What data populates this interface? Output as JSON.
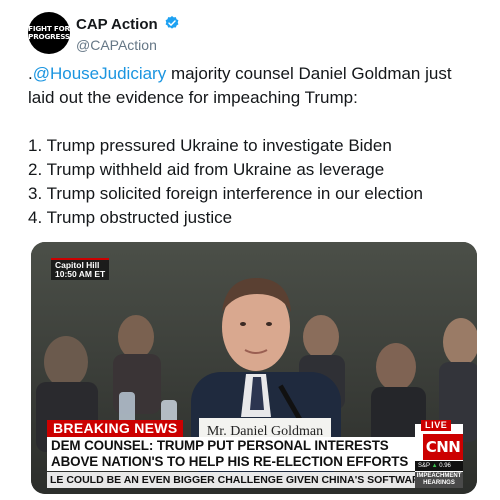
{
  "tweet": {
    "avatar_lines": [
      "FIGHT FOR",
      "PROGRESS"
    ],
    "display_name": "CAP Action",
    "verified": true,
    "handle": "@CAPAction",
    "text_line1_prefix": ".",
    "mention": "@HouseJudiciary",
    "text_line1_rest": " majority counsel Daniel Goldman just",
    "text_line2": "laid out the evidence for impeaching Trump:",
    "points": [
      "1. Trump pressured Ukraine to investigate Biden",
      "2. Trump withheld aid from Ukraine as leverage",
      "3. Trump solicited foreign interference in our election",
      "4. Trump obstructed justice"
    ]
  },
  "media": {
    "location_bug": "Capitol Hill",
    "time_bug": "10:50 AM ET",
    "nameplate": "Mr. Daniel Goldman",
    "breaking_label": "BREAKING NEWS",
    "headline_lines": [
      "DEM COUNSEL: TRUMP PUT PERSONAL INTERESTS",
      "ABOVE NATION'S TO HELP HIS RE-ELECTION EFFORTS"
    ],
    "live_label": "LIVE",
    "network_logo": "CNN",
    "market_label": "S&P",
    "market_arrow": "▲",
    "market_value": "0.96",
    "crawl_text": "LE COULD BE AN EVEN BIGGER CHALLENGE GIVEN CHINA'S SOFTWARE INDU",
    "program_tag_lines": [
      "IMPEACHMENT",
      "HEARINGS"
    ]
  },
  "colors": {
    "mention": "#1b95e0",
    "verified": "#1da1f2",
    "cnn_red": "#cc0000",
    "handle_gray": "#657786"
  }
}
